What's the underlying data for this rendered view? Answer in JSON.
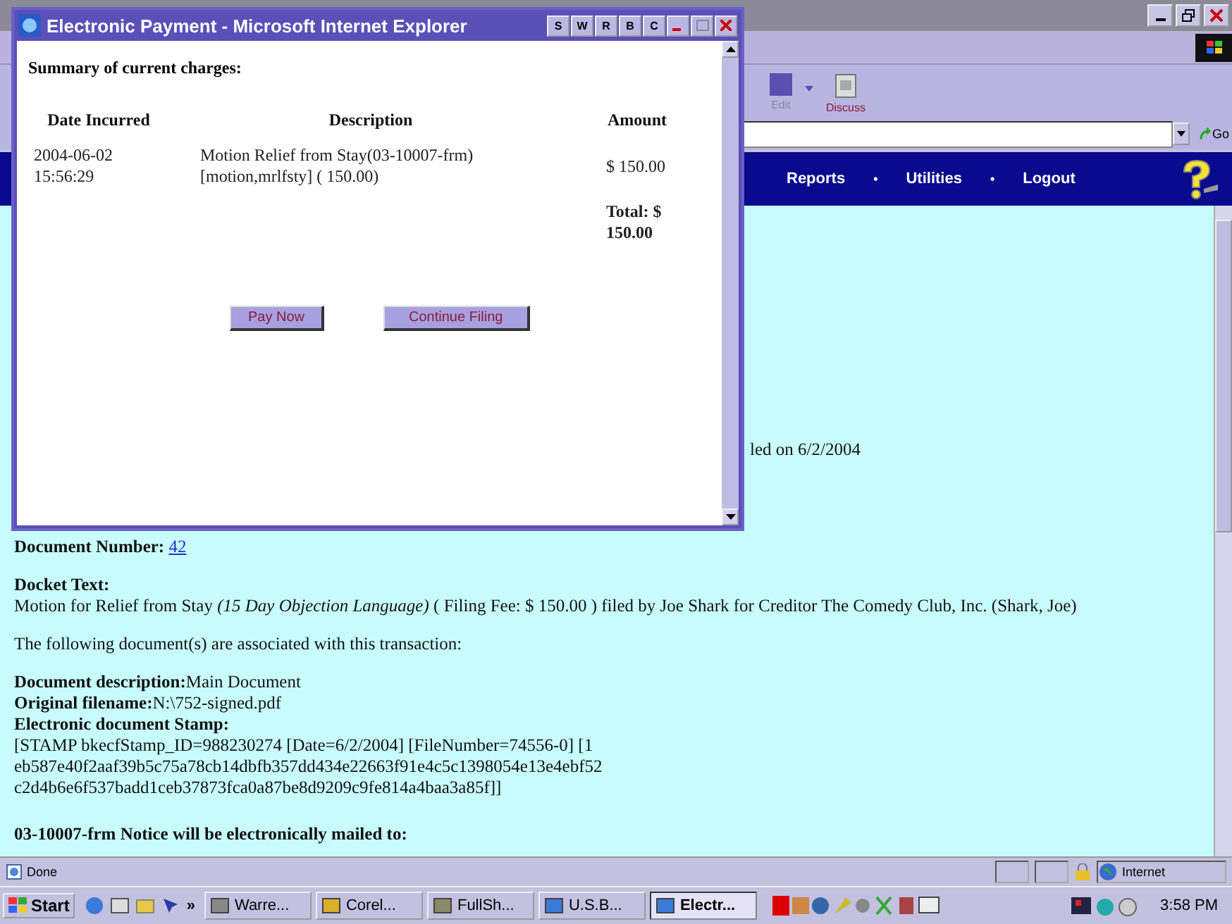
{
  "toolbar": {
    "buttons": [
      {
        "label": "Edit",
        "disabled": true
      },
      {
        "label": "Discuss",
        "disabled": false
      }
    ],
    "go": "Go"
  },
  "nav": {
    "items": [
      "Reports",
      "Utilities",
      "Logout"
    ],
    "separator": "•"
  },
  "content": {
    "filed_fragment": "led on 6/2/2004",
    "document_number": {
      "label": "Document Number:",
      "link": "42"
    },
    "docket_label": "Docket Text:",
    "docket_text": "Motion for Relief from Stay *(15 Day Objection Language)* ( Filing Fee: $ 150.00 ) filed by Joe Shark for Creditor The Comedy Club, Inc. (Shark, Joe)",
    "associated": "The following document(s) are associated with this transaction:",
    "fields": [
      {
        "label": "Document description:",
        "value": "Main Document"
      },
      {
        "label": "Original filename:",
        "value": "N:\\752-signed.pdf"
      }
    ],
    "stamp_label": "Electronic document Stamp:",
    "stamp_lines": [
      "[STAMP bkecfStamp_ID=988230274 [Date=6/2/2004] [FileNumber=74556-0] [1",
      "eb587e40f2aaf39b5c75a78cb14dbfb357dd434e22663f91e4c5c1398054e13e4ebf52",
      "c2d4b6e6f537badd1ceb37873fca0a87be8d9209c9fe814a4baa3a85f]]"
    ],
    "notice": "03-10007-frm Notice will be electronically mailed to:"
  },
  "status_bar": {
    "text": "Done",
    "zone": "Internet"
  },
  "taskbar": {
    "start": "Start",
    "chevron": "»",
    "tasks": [
      {
        "label": "Warre...",
        "selected": false
      },
      {
        "label": "Corel...",
        "selected": false
      },
      {
        "label": "FullSh...",
        "selected": false
      },
      {
        "label": "U.S.B...",
        "selected": false
      },
      {
        "label": "Electr...",
        "selected": true
      }
    ],
    "clock": "3:58 PM"
  },
  "popup": {
    "title": "Electronic Payment - Microsoft Internet Explorer",
    "title_buttons": [
      "S",
      "W",
      "R",
      "B",
      "C"
    ],
    "heading": "Summary of current charges:",
    "columns": [
      "Date Incurred",
      "Description",
      "Amount"
    ],
    "rows": [
      {
        "date": "2004-06-02 15:56:29",
        "description": "Motion Relief from Stay(03-10007-frm) [motion,mrlfsty] ( 150.00)",
        "amount": "$ 150.00"
      }
    ],
    "total": "Total: $ 150.00",
    "buttons": [
      "Pay Now",
      "Continue Filing"
    ]
  }
}
